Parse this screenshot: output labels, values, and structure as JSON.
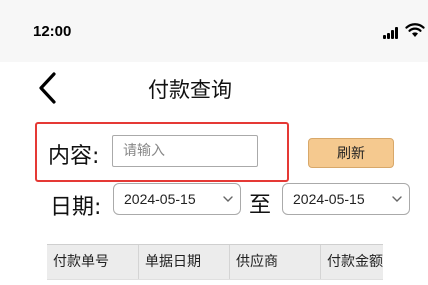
{
  "status_bar": {
    "time": "12:00"
  },
  "header": {
    "title": "付款查询"
  },
  "search": {
    "label": "内容:",
    "placeholder": "请输入",
    "value": ""
  },
  "toolbar": {
    "refresh_label": "刷新"
  },
  "date_filter": {
    "label": "日期:",
    "start": "2024-05-15",
    "separator": "至",
    "end": "2024-05-15"
  },
  "table": {
    "columns": [
      "付款单号",
      "单据日期",
      "供应商",
      "付款金额"
    ],
    "rows": []
  },
  "colors": {
    "refresh_bg": "#f5c98f",
    "highlight_border": "#e53935"
  }
}
